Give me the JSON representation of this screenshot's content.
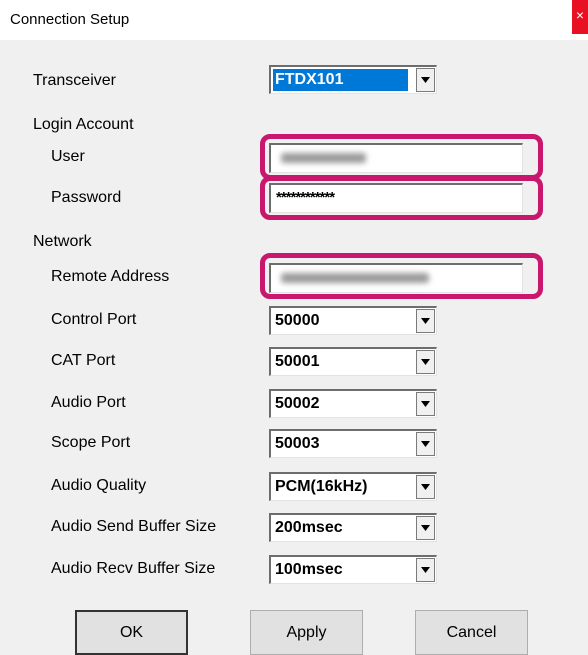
{
  "window": {
    "title": "Connection Setup",
    "close_glyph": "×"
  },
  "transceiver": {
    "label": "Transceiver",
    "value": "FTDX101"
  },
  "login": {
    "heading": "Login Account",
    "user_label": "User",
    "password_label": "Password",
    "password_value": "************"
  },
  "network": {
    "heading": "Network",
    "remote_label": "Remote Address",
    "ports": [
      {
        "label": "Control Port",
        "value": "50000"
      },
      {
        "label": "CAT Port",
        "value": "50001"
      },
      {
        "label": "Audio Port",
        "value": "50002"
      },
      {
        "label": "Scope Port",
        "value": "50003"
      },
      {
        "label": "Audio Quality",
        "value": "PCM(16kHz)"
      },
      {
        "label": "Audio Send Buffer Size",
        "value": "200msec"
      },
      {
        "label": "Audio Recv Buffer Size",
        "value": "100msec"
      }
    ]
  },
  "buttons": {
    "ok": "OK",
    "apply": "Apply",
    "cancel": "Cancel"
  },
  "colors": {
    "highlight": "#c8176c",
    "selection": "#0078d7",
    "close": "#e81123"
  }
}
